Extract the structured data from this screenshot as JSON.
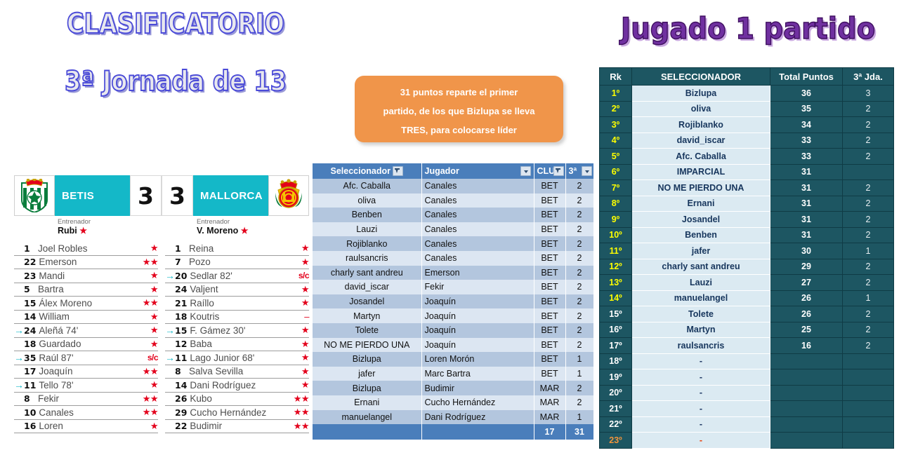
{
  "titles": {
    "left_line1": "CLASIFICATORIO",
    "left_line2": "3ª Jornada de 13",
    "right": "Jugado 1 partido"
  },
  "callout": {
    "line1": "31 puntos reparte el primer",
    "line2": "partido, de los que Bizlupa se lleva",
    "line3": "TRES, para colocarse líder",
    "bg_color": "#f0954a"
  },
  "match": {
    "home": {
      "name": "BETIS",
      "goals": "3",
      "coach_label": "Entrenador",
      "coach_name": "Rubi",
      "coach_star": "★"
    },
    "away": {
      "name": "MALLORCA",
      "goals": "3",
      "coach_label": "Entrenador",
      "coach_name": "V. Moreno",
      "coach_star": "★"
    },
    "band_color": "#14b8c8",
    "star_color": "#e3001b"
  },
  "lineups": {
    "home": [
      {
        "sub": "",
        "num": "1",
        "name": "Joel Robles",
        "rate": "★"
      },
      {
        "sub": "",
        "num": "22",
        "name": "Emerson",
        "rate": "★★"
      },
      {
        "sub": "",
        "num": "23",
        "name": "Mandi",
        "rate": "★"
      },
      {
        "sub": "",
        "num": "5",
        "name": "Bartra",
        "rate": "★"
      },
      {
        "sub": "",
        "num": "15",
        "name": "Álex Moreno",
        "rate": "★★"
      },
      {
        "sub": "",
        "num": "14",
        "name": "William",
        "rate": "★"
      },
      {
        "sub": "→",
        "num": "24",
        "name": "Aleñá 74'",
        "rate": "★"
      },
      {
        "sub": "",
        "num": "18",
        "name": "Guardado",
        "rate": "★"
      },
      {
        "sub": "→",
        "num": "35",
        "name": "Raúl 87'",
        "rate": "s/c"
      },
      {
        "sub": "",
        "num": "17",
        "name": "Joaquín",
        "rate": "★★"
      },
      {
        "sub": "→",
        "num": "11",
        "name": "Tello 78'",
        "rate": "★"
      },
      {
        "sub": "",
        "num": "8",
        "name": "Fekir",
        "rate": "★★"
      },
      {
        "sub": "",
        "num": "10",
        "name": "Canales",
        "rate": "★★"
      },
      {
        "sub": "",
        "num": "16",
        "name": "Loren",
        "rate": "★"
      }
    ],
    "away": [
      {
        "sub": "",
        "num": "1",
        "name": "Reina",
        "rate": "★"
      },
      {
        "sub": "",
        "num": "7",
        "name": "Pozo",
        "rate": "★"
      },
      {
        "sub": "→",
        "num": "20",
        "name": "Sedlar 82'",
        "rate": "s/c"
      },
      {
        "sub": "",
        "num": "24",
        "name": "Valjent",
        "rate": "★"
      },
      {
        "sub": "",
        "num": "21",
        "name": "Raíllo",
        "rate": "★"
      },
      {
        "sub": "",
        "num": "18",
        "name": "Koutris",
        "rate": "–"
      },
      {
        "sub": "→",
        "num": "15",
        "name": "F. Gámez 30'",
        "rate": "★"
      },
      {
        "sub": "",
        "num": "12",
        "name": "Baba",
        "rate": "★"
      },
      {
        "sub": "→",
        "num": "11",
        "name": "Lago Junior 68'",
        "rate": "★"
      },
      {
        "sub": "",
        "num": "8",
        "name": "Salva Sevilla",
        "rate": "★"
      },
      {
        "sub": "",
        "num": "14",
        "name": "Dani Rodríguez",
        "rate": "★"
      },
      {
        "sub": "",
        "num": "26",
        "name": "Kubo",
        "rate": "★★"
      },
      {
        "sub": "",
        "num": "29",
        "name": "Cucho Hernández",
        "rate": "★★"
      },
      {
        "sub": "",
        "num": "22",
        "name": "Budimir",
        "rate": "★★"
      }
    ]
  },
  "picks_table": {
    "headers": [
      "Seleccionador",
      "Jugador",
      "CLU",
      "3ª"
    ],
    "rows": [
      {
        "sel": "Afc. Caballa",
        "plr": "Canales",
        "club": "BET",
        "pts": "2"
      },
      {
        "sel": "oliva",
        "plr": "Canales",
        "club": "BET",
        "pts": "2"
      },
      {
        "sel": "Benben",
        "plr": "Canales",
        "club": "BET",
        "pts": "2"
      },
      {
        "sel": "Lauzi",
        "plr": "Canales",
        "club": "BET",
        "pts": "2"
      },
      {
        "sel": "Rojiblanko",
        "plr": "Canales",
        "club": "BET",
        "pts": "2"
      },
      {
        "sel": "raulsancris",
        "plr": "Canales",
        "club": "BET",
        "pts": "2"
      },
      {
        "sel": "charly sant andreu",
        "plr": "Emerson",
        "club": "BET",
        "pts": "2"
      },
      {
        "sel": "david_iscar",
        "plr": "Fekir",
        "club": "BET",
        "pts": "2"
      },
      {
        "sel": "Josandel",
        "plr": "Joaquín",
        "club": "BET",
        "pts": "2"
      },
      {
        "sel": "Martyn",
        "plr": "Joaquín",
        "club": "BET",
        "pts": "2"
      },
      {
        "sel": "Tolete",
        "plr": "Joaquín",
        "club": "BET",
        "pts": "2"
      },
      {
        "sel": "NO ME PIERDO UNA",
        "plr": "Joaquín",
        "club": "BET",
        "pts": "2"
      },
      {
        "sel": "Bizlupa",
        "plr": "Loren Morón",
        "club": "BET",
        "pts": "1"
      },
      {
        "sel": "jafer",
        "plr": "Marc Bartra",
        "club": "BET",
        "pts": "1"
      },
      {
        "sel": "Bizlupa",
        "plr": "Budimir",
        "club": "MAR",
        "pts": "2"
      },
      {
        "sel": "Ernani",
        "plr": "Cucho Hernández",
        "club": "MAR",
        "pts": "2"
      },
      {
        "sel": "manuelangel",
        "plr": "Dani Rodríguez",
        "club": "MAR",
        "pts": "1"
      }
    ],
    "total": {
      "sel": "",
      "plr": "",
      "club": "17",
      "pts": "31"
    }
  },
  "ranking": {
    "headers": [
      "Rk",
      "SELECCIONADOR",
      "Total Puntos",
      "3ª Jda."
    ],
    "rows": [
      {
        "rk": "1º",
        "name": "Bizlupa",
        "pts": "36",
        "jda": "3",
        "rk_color": "yellow"
      },
      {
        "rk": "2º",
        "name": "oliva",
        "pts": "35",
        "jda": "2",
        "rk_color": "yellow"
      },
      {
        "rk": "3º",
        "name": "Rojiblanko",
        "pts": "34",
        "jda": "2",
        "rk_color": "yellow"
      },
      {
        "rk": "4º",
        "name": "david_iscar",
        "pts": "33",
        "jda": "2",
        "rk_color": "yellow"
      },
      {
        "rk": "5º",
        "name": "Afc. Caballa",
        "pts": "33",
        "jda": "2",
        "rk_color": "yellow"
      },
      {
        "rk": "6º",
        "name": "IMPARCIAL",
        "pts": "31",
        "jda": "",
        "rk_color": "yellow"
      },
      {
        "rk": "7º",
        "name": "NO ME PIERDO UNA",
        "pts": "31",
        "jda": "2",
        "rk_color": "yellow"
      },
      {
        "rk": "8º",
        "name": "Ernani",
        "pts": "31",
        "jda": "2",
        "rk_color": "yellow"
      },
      {
        "rk": "9º",
        "name": "Josandel",
        "pts": "31",
        "jda": "2",
        "rk_color": "yellow"
      },
      {
        "rk": "10º",
        "name": "Benben",
        "pts": "31",
        "jda": "2",
        "rk_color": "yellow"
      },
      {
        "rk": "11º",
        "name": "jafer",
        "pts": "30",
        "jda": "1",
        "rk_color": "yellow"
      },
      {
        "rk": "12º",
        "name": "charly sant andreu",
        "pts": "29",
        "jda": "2",
        "rk_color": "yellow"
      },
      {
        "rk": "13º",
        "name": "Lauzi",
        "pts": "27",
        "jda": "2",
        "rk_color": "yellow"
      },
      {
        "rk": "14º",
        "name": "manuelangel",
        "pts": "26",
        "jda": "1",
        "rk_color": "yellow"
      },
      {
        "rk": "15º",
        "name": "Tolete",
        "pts": "26",
        "jda": "2",
        "rk_color": "white"
      },
      {
        "rk": "16º",
        "name": "Martyn",
        "pts": "25",
        "jda": "2",
        "rk_color": "white"
      },
      {
        "rk": "17º",
        "name": "raulsancris",
        "pts": "16",
        "jda": "2",
        "rk_color": "white"
      },
      {
        "rk": "18º",
        "name": "-",
        "pts": "",
        "jda": "",
        "rk_color": "white"
      },
      {
        "rk": "19º",
        "name": "-",
        "pts": "",
        "jda": "",
        "rk_color": "white"
      },
      {
        "rk": "20º",
        "name": "-",
        "pts": "",
        "jda": "",
        "rk_color": "white"
      },
      {
        "rk": "21º",
        "name": "-",
        "pts": "",
        "jda": "",
        "rk_color": "white"
      },
      {
        "rk": "22º",
        "name": "-",
        "pts": "",
        "jda": "",
        "rk_color": "white"
      },
      {
        "rk": "23º",
        "name": "-",
        "pts": "",
        "jda": "",
        "rk_color": "orange"
      }
    ],
    "header_bg": "#1d5662",
    "name_bg": "#dbeaf2"
  }
}
